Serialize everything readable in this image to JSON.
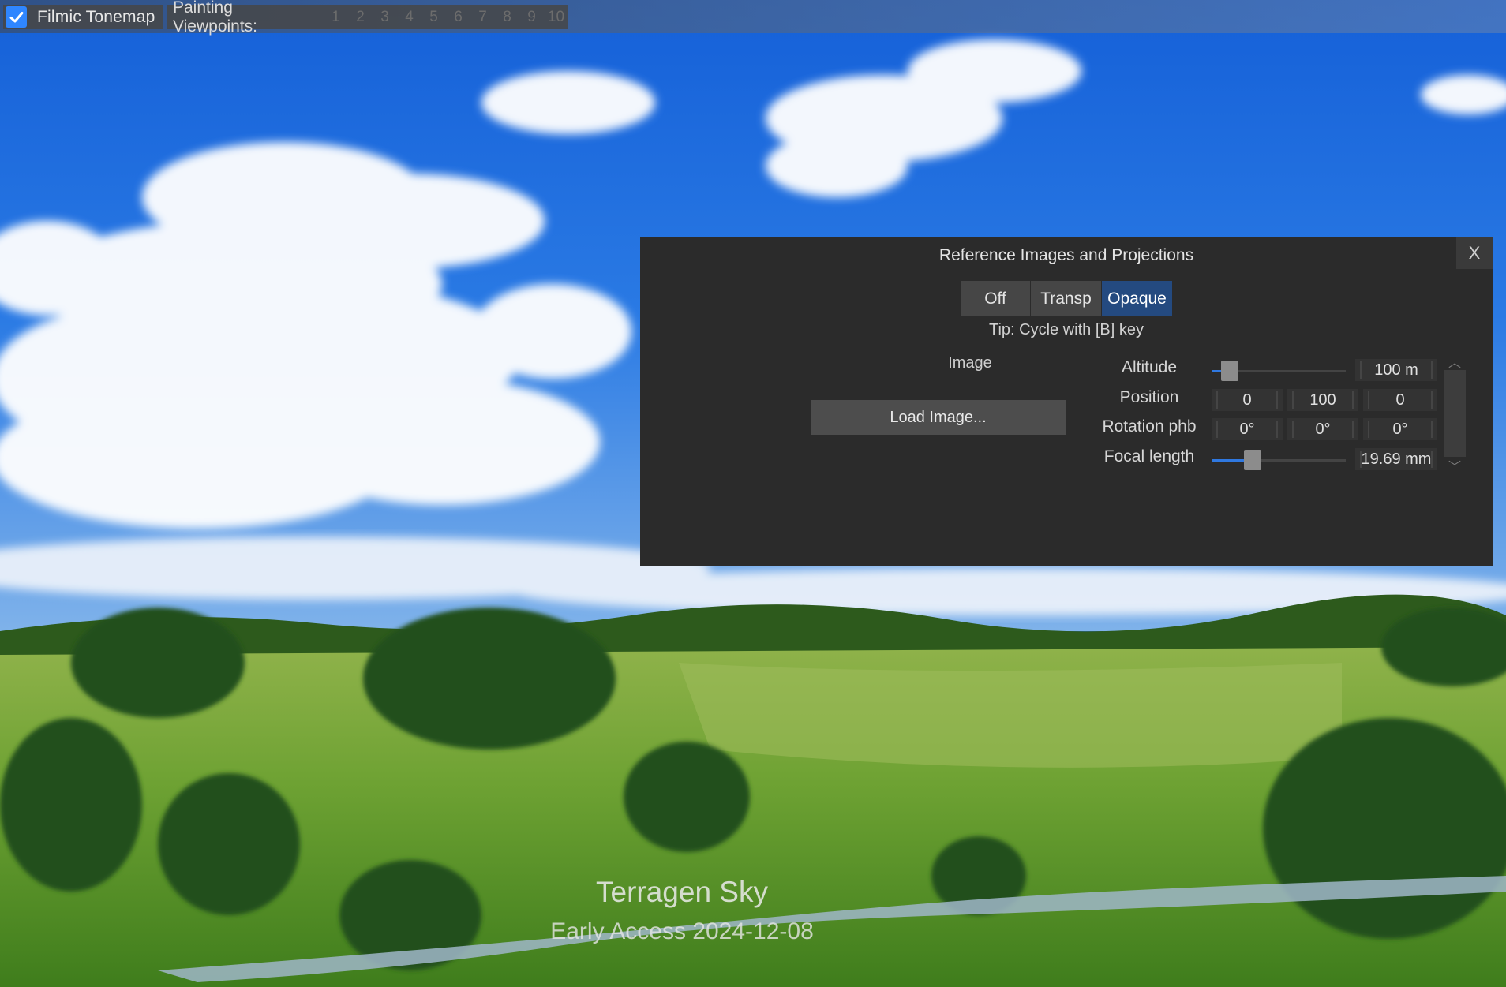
{
  "toolbar": {
    "filmic_tonemap": {
      "label": "Filmic Tonemap",
      "checked": true
    },
    "painting_viewpoints": {
      "label": "Painting Viewpoints:",
      "numbers": [
        "1",
        "2",
        "3",
        "4",
        "5",
        "6",
        "7",
        "8",
        "9",
        "10"
      ]
    }
  },
  "dialog": {
    "title": "Reference Images and Projections",
    "close_label": "X",
    "modes": [
      {
        "label": "Off",
        "active": false
      },
      {
        "label": "Transp",
        "active": false
      },
      {
        "label": "Opaque",
        "active": true
      }
    ],
    "tip": "Tip: Cycle with [B] key",
    "image_label": "Image",
    "load_button": "Load Image...",
    "properties": {
      "altitude": {
        "label": "Altitude",
        "value": "100 m",
        "slider_fraction": 0.08
      },
      "position": {
        "label": "Position",
        "x": "0",
        "y": "100",
        "z": "0"
      },
      "rotation": {
        "label": "Rotation phb",
        "h": "0°",
        "p": "0°",
        "b": "0°"
      },
      "focal_length": {
        "label": "Focal length",
        "value": "19.69 mm",
        "slider_fraction": 0.28
      }
    },
    "scroll_up": "︿",
    "scroll_down": "﹀"
  },
  "watermark": {
    "line1": "Terragen Sky",
    "line2": "Early Access 2024-12-08"
  },
  "colors": {
    "accent": "#2f86ff",
    "active_mode": "#244a80",
    "dialog_bg": "#2b2b2b"
  }
}
